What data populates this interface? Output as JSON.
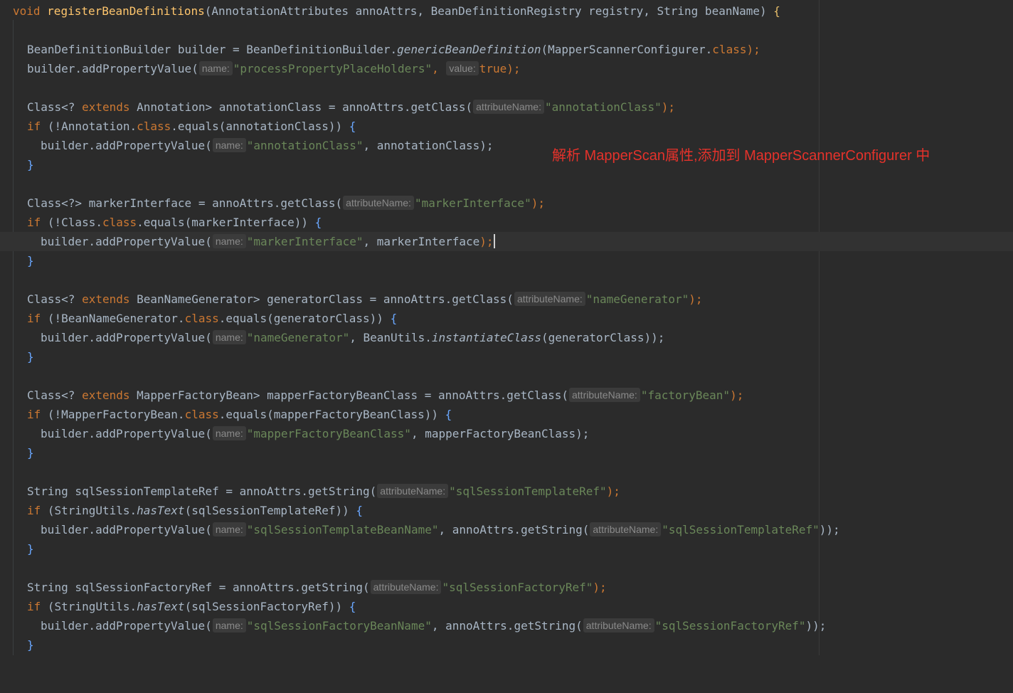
{
  "code": {
    "method_void": "void",
    "method_name": "registerBeanDefinitions",
    "method_params": "(AnnotationAttributes annoAttrs, BeanDefinitionRegistry registry, String beanName)",
    "open_brace": "{",
    "builder_decl_1": "BeanDefinitionBuilder builder = BeanDefinitionBuilder.",
    "builder_decl_call": "genericBeanDefinition",
    "builder_decl_arg": "(MapperScannerConfigurer.",
    "class_kw": "class",
    "close_semicolon": ");",
    "add_prop_prefix": "builder.addPropertyValue(",
    "hint_name": "name:",
    "hint_value": "value:",
    "hint_attribute": "attributeName:",
    "str_process": "\"processPropertyPlaceHolders\"",
    "true_kw": "true",
    "class_generic": "Class<? ",
    "extends_kw": "extends",
    "annotation_type": " Annotation> annotationClass = annoAttrs.getClass(",
    "str_annotationClass": "\"annotationClass\"",
    "if_kw": "if",
    "if_annotation": " (!Annotation.",
    "equals_annotation": ".equals(annotationClass)) ",
    "annotation_var": ", annotationClass);",
    "close_brace": "}",
    "marker_decl": "Class<?> markerInterface = annoAttrs.getClass(",
    "str_markerInterface": "\"markerInterface\"",
    "if_class": " (!Class.",
    "equals_marker": ".equals(markerInterface)) ",
    "marker_var": ", markerInterface",
    "semicolon_close": ");",
    "generator_type": " BeanNameGenerator> generatorClass = annoAttrs.getClass(",
    "str_nameGenerator": "\"nameGenerator\"",
    "if_generator": " (!BeanNameGenerator.",
    "equals_generator": ".equals(generatorClass)) ",
    "bean_utils": ", BeanUtils.",
    "instantiate_class": "instantiateClass",
    "generator_arg": "(generatorClass));",
    "factory_type": " MapperFactoryBean> mapperFactoryBeanClass = annoAttrs.getClass(",
    "str_factoryBean": "\"factoryBean\"",
    "if_factory": " (!MapperFactoryBean.",
    "equals_factory": ".equals(mapperFactoryBeanClass)) ",
    "str_mapperFactoryBeanClass": "\"mapperFactoryBeanClass\"",
    "factory_var": ", mapperFactoryBeanClass);",
    "template_decl": "String sqlSessionTemplateRef = annoAttrs.getString(",
    "str_sqlSessionTemplateRef": "\"sqlSessionTemplateRef\"",
    "if_stringutils": " (StringUtils.",
    "has_text": "hasText",
    "template_arg": "(sqlSessionTemplateRef)) ",
    "str_sqlSessionTemplateBeanName": "\"sqlSessionTemplateBeanName\"",
    "get_string_inline": ", annoAttrs.getString(",
    "close_double": "));",
    "factory_ref_decl": "String sqlSessionFactoryRef = annoAttrs.getString(",
    "str_sqlSessionFactoryRef": "\"sqlSessionFactoryRef\"",
    "factory_ref_arg": "(sqlSessionFactoryRef)) ",
    "str_sqlSessionFactoryBeanName": "\"sqlSessionFactoryBeanName\"",
    "comma_space": ", "
  },
  "annotation_text": "解析 MapperScan属性,添加到 MapperScannerConfigurer 中",
  "colors": {
    "background": "#2b2b2b",
    "keyword": "#cc7832",
    "string": "#6a8759",
    "method": "#ffc66d",
    "annotation_red": "#e5322b"
  }
}
